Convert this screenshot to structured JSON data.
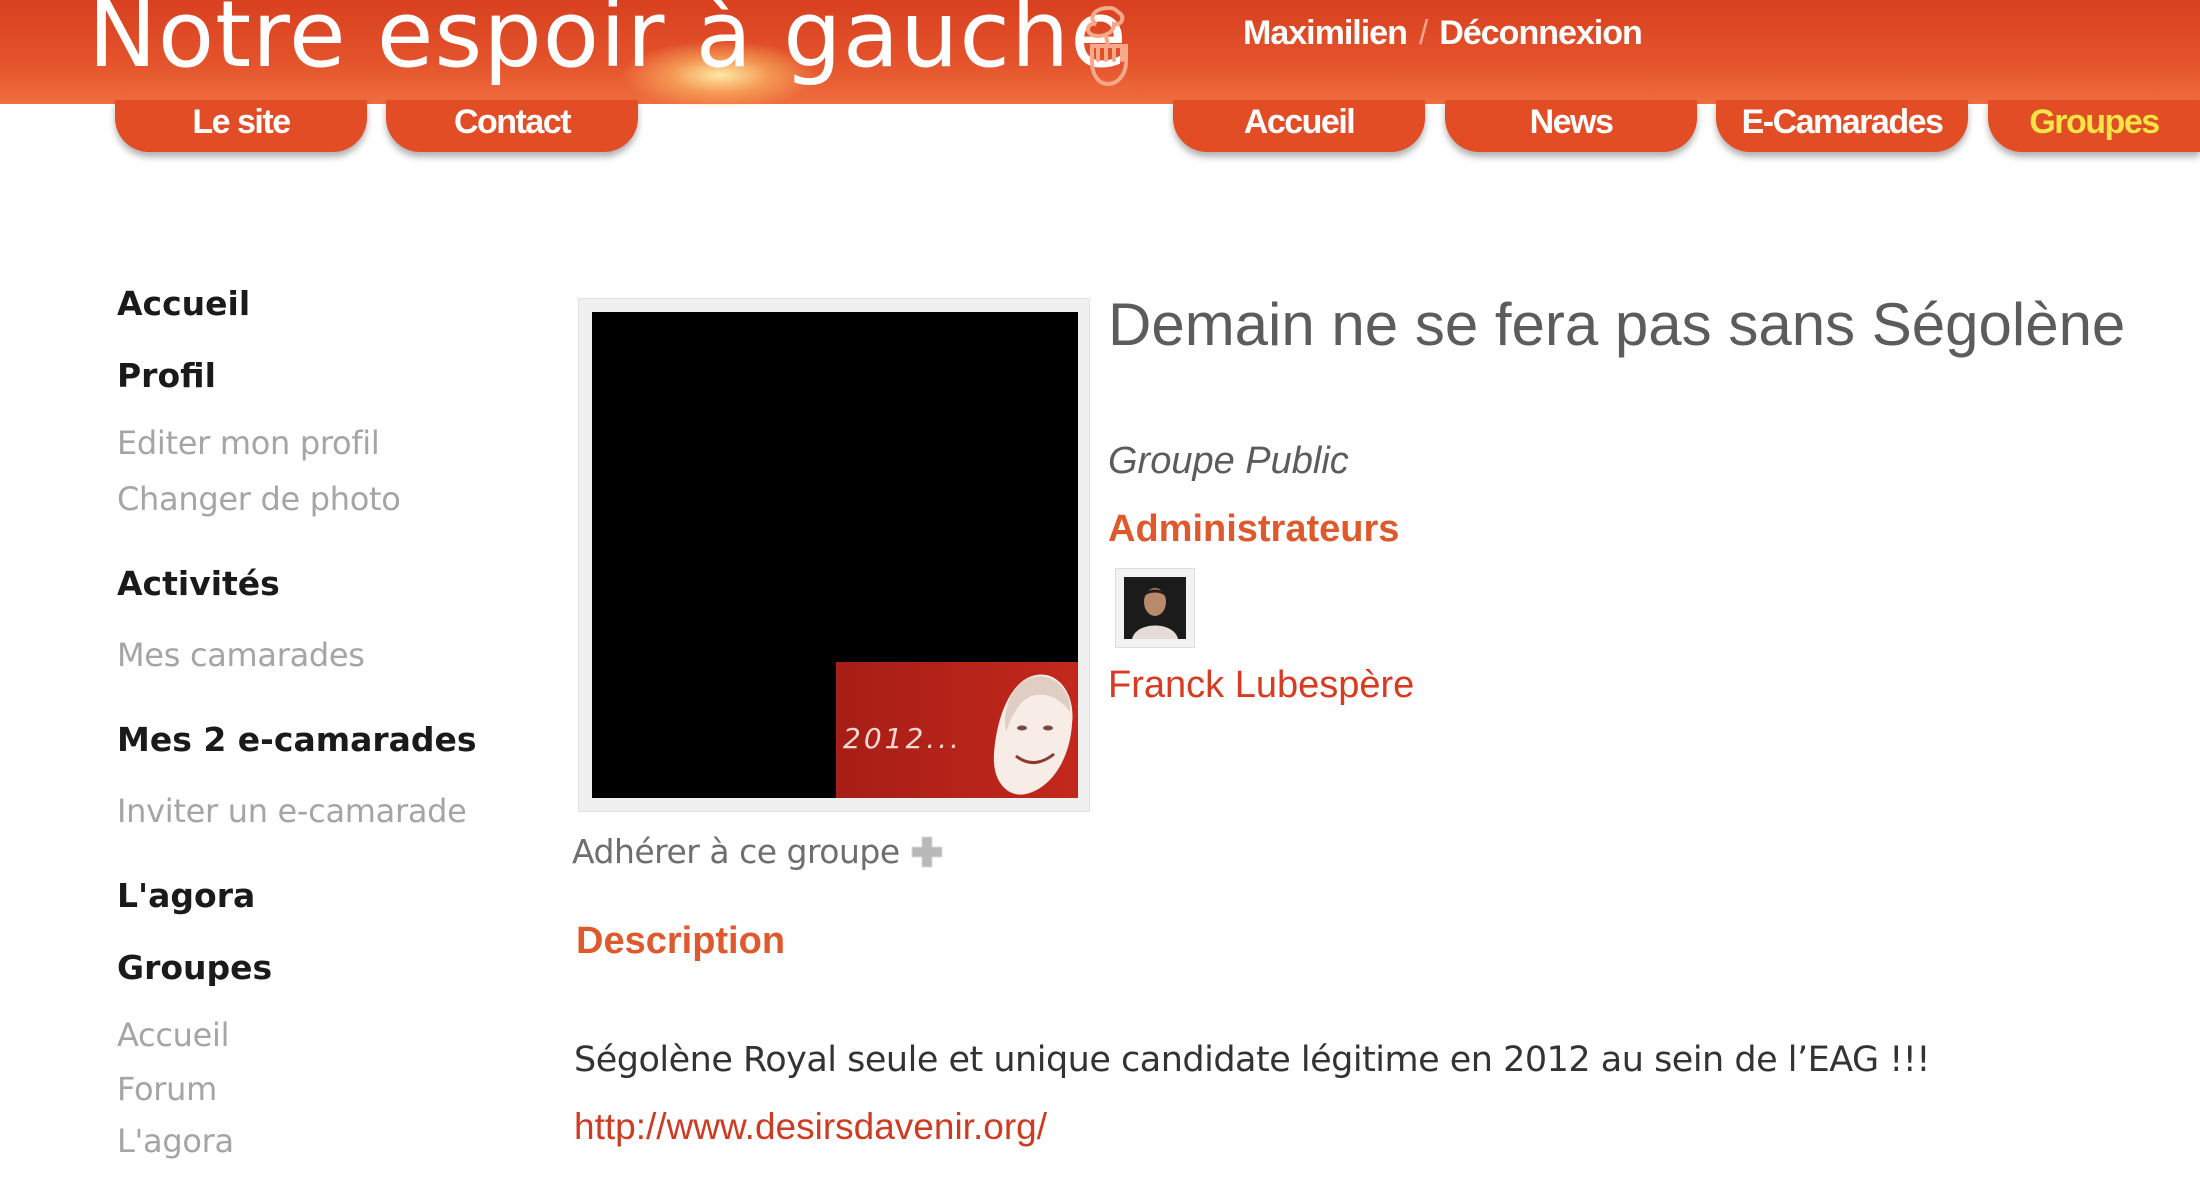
{
  "header": {
    "site_title": "Notre espoir à gauche",
    "user_name": "Maximilien",
    "separator": "/",
    "logout": "Déconnexion",
    "left_tabs": [
      "Le site",
      "Contact"
    ],
    "right_tabs": [
      "Accueil",
      "News",
      "E-Camarades",
      "Groupes"
    ],
    "active_tab": "Groupes",
    "colors": {
      "band": "#e24d25",
      "active_tab_text": "#f7e545"
    }
  },
  "sidebar": {
    "accueil": "Accueil",
    "profil": "Profil",
    "profil_items": [
      "Editer mon profil",
      "Changer de photo"
    ],
    "activites": "Activités",
    "activites_items": [
      "Mes camarades"
    ],
    "mes_camarades": "Mes 2 e-camarades",
    "mes_camarades_items": [
      "Inviter un e-camarade"
    ],
    "agora": "L'agora",
    "groupes": "Groupes",
    "groupes_items": [
      "Accueil",
      "Forum",
      "L'agora"
    ]
  },
  "group": {
    "image_caption": "2012...",
    "join_label": "Adhérer à ce groupe",
    "title": "Demain ne se fera pas sans Ségolène",
    "type": "Groupe Public",
    "admins_heading": "Administrateurs",
    "admin_name": "Franck Lubespère",
    "description_heading": "Description",
    "description_text": "Ségolène Royal seule et unique candidate légitime en 2012 au sein de l’EAG !!!",
    "description_link": "http://www.desirsdavenir.org/",
    "colors": {
      "heading": "#de5a2c",
      "link": "#cf3a22"
    }
  }
}
